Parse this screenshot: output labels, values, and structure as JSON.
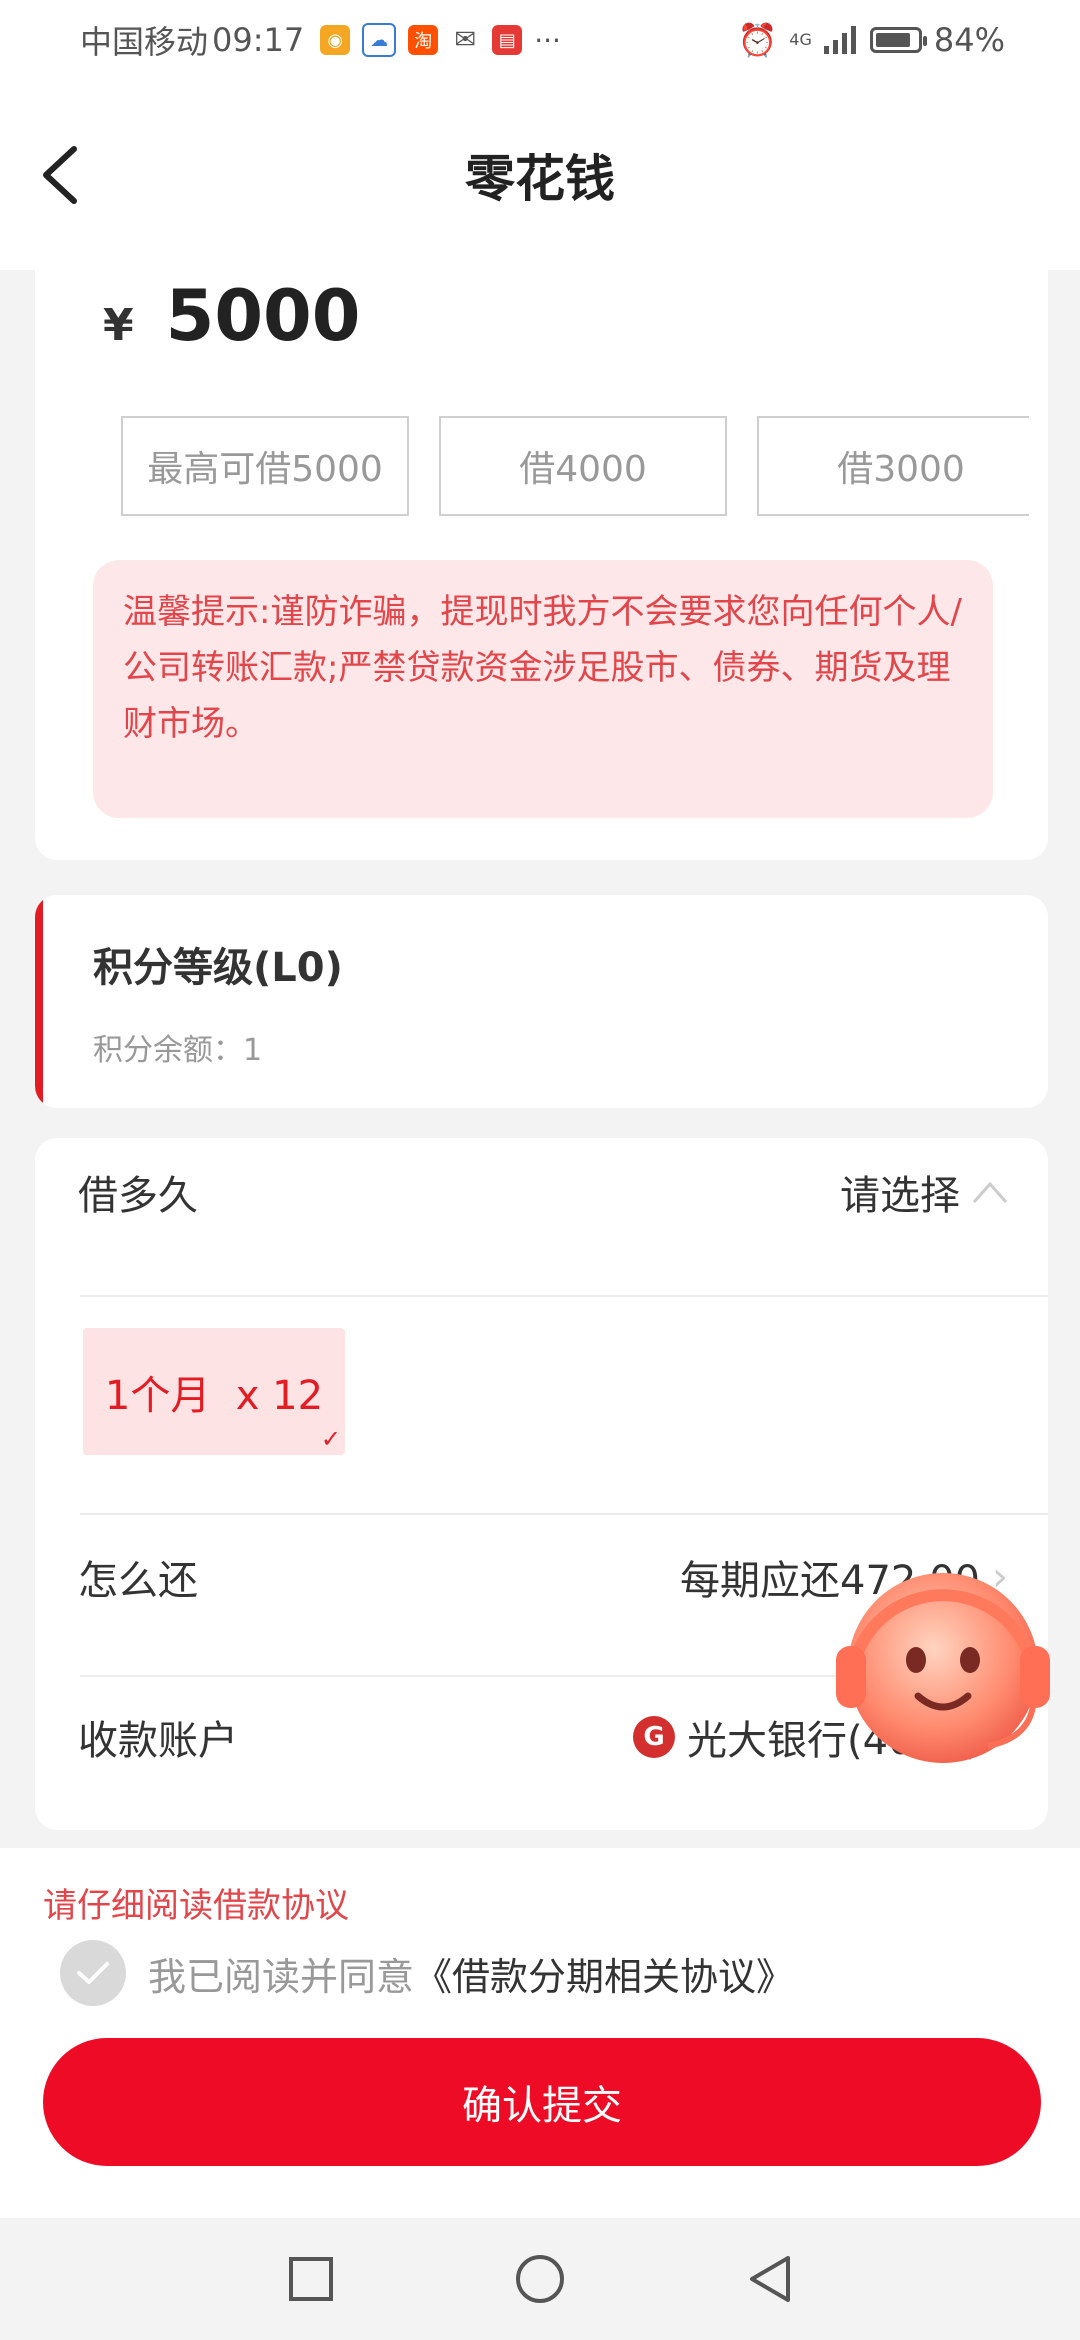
{
  "status_bar": {
    "carrier": "中国移动",
    "time": "09:17",
    "network": "4G",
    "battery": "84%",
    "battery_level": 0.84,
    "notification_icons": [
      "weibo-icon",
      "cloud-icon",
      "taobao-icon",
      "wechat-icon",
      "book-icon",
      "more-icon"
    ]
  },
  "header": {
    "title": "零花钱"
  },
  "amount_card": {
    "currency": "¥",
    "amount": "5000",
    "options": [
      "最高可借5000",
      "借4000",
      "借3000"
    ],
    "tip": "温馨提示:谨防诈骗，提现时我方不会要求您向任何个人/公司转账汇款;严禁贷款资金涉足股市、债券、期货及理财市场。"
  },
  "points_card": {
    "title": "积分等级(L0)",
    "balance": "积分余额：1"
  },
  "terms_card": {
    "duration_label": "借多久",
    "duration_value": "请选择",
    "term_option": "1个月  x 12",
    "repay_label": "怎么还",
    "repay_value": "每期应还472.00",
    "account_label": "收款账户",
    "account_value": "光大银行(4067)"
  },
  "bottom": {
    "warning": "请仔细阅读借款协议",
    "agree_text": "我已阅读并同意",
    "agree_link": "《借款分期相关协议》",
    "submit_label": "确认提交"
  },
  "colors": {
    "accent": "#ee0b25",
    "tip_bg": "#fde7e8",
    "tip_text": "#e2454a"
  }
}
